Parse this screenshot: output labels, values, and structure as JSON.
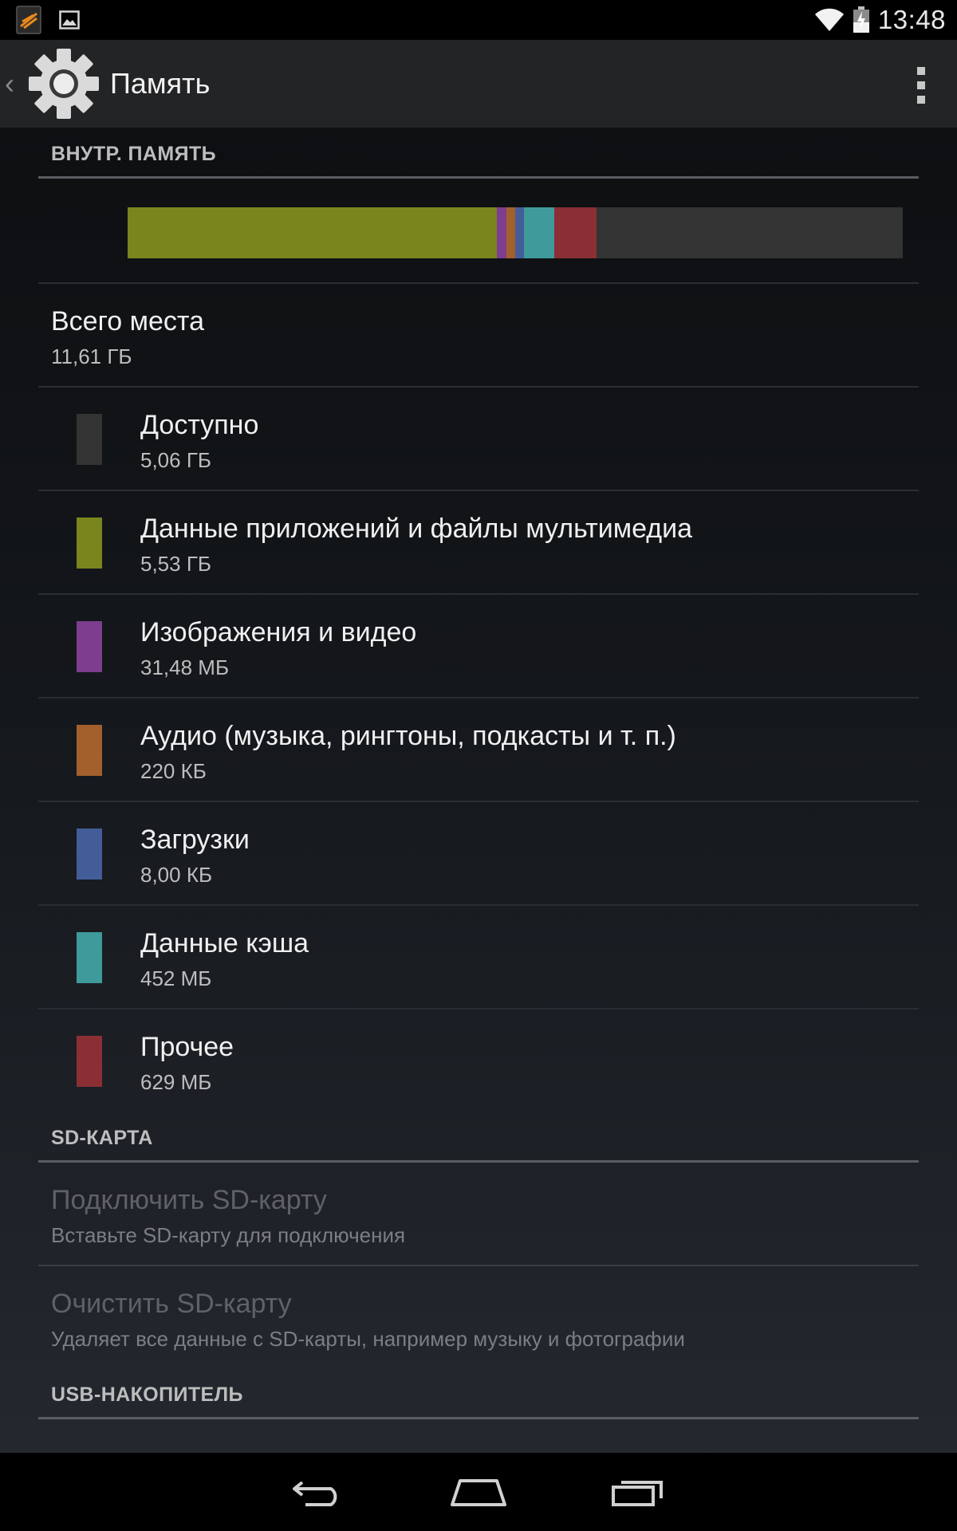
{
  "status_bar": {
    "time": "13:48",
    "left_icons": [
      "app-notification-icon",
      "image-notification-icon"
    ],
    "right_icons": [
      "wifi-icon",
      "battery-charging-icon"
    ]
  },
  "action_bar": {
    "title": "Память",
    "app_icon": "settings-gear-icon",
    "up_icon": "up-caret-icon",
    "menu_icon": "overflow-menu-icon"
  },
  "internal_storage": {
    "header": "ВНУТР. ПАМЯТЬ",
    "usage_segments": [
      {
        "name": "apps",
        "fraction": 0.4763,
        "color": "#7a851e"
      },
      {
        "name": "images",
        "fraction": 0.0126,
        "color": "#7e3d8e"
      },
      {
        "name": "audio",
        "fraction": 0.0114,
        "color": "#a3602c"
      },
      {
        "name": "downloads",
        "fraction": 0.0114,
        "color": "#435d99"
      },
      {
        "name": "cache",
        "fraction": 0.0389,
        "color": "#3f9a9b"
      },
      {
        "name": "misc",
        "fraction": 0.0542,
        "color": "#8b2f35"
      }
    ],
    "usage_bar_background": "#333333",
    "total": {
      "title": "Всего места",
      "value": "11,61 ГБ"
    },
    "categories": [
      {
        "title": "Доступно",
        "value": "5,06 ГБ",
        "color": "#333333"
      },
      {
        "title": "Данные приложений и файлы мультимедиа",
        "value": "5,53 ГБ",
        "color": "#7a851e"
      },
      {
        "title": "Изображения и видео",
        "value": "31,48 МБ",
        "color": "#7e3d8e"
      },
      {
        "title": "Аудио (музыка, рингтоны, подкасты и т. п.)",
        "value": "220 КБ",
        "color": "#a3602c"
      },
      {
        "title": "Загрузки",
        "value": "8,00 КБ",
        "color": "#435d99"
      },
      {
        "title": "Данные кэша",
        "value": "452 МБ",
        "color": "#3f9a9b"
      },
      {
        "title": "Прочее",
        "value": "629 МБ",
        "color": "#8b2f35"
      }
    ]
  },
  "sd_card": {
    "header": "SD-КАРТА",
    "items": [
      {
        "title": "Подключить SD-карту",
        "summary": "Вставьте SD-карту для подключения"
      },
      {
        "title": "Очистить SD-карту",
        "summary": "Удаляет все данные с SD-карты, например музыку и фотографии"
      }
    ]
  },
  "usb_storage": {
    "header": "USB-НАКОПИТЕЛЬ"
  },
  "nav_bar": {
    "icons": [
      "back-icon",
      "home-icon",
      "recent-apps-icon"
    ]
  }
}
